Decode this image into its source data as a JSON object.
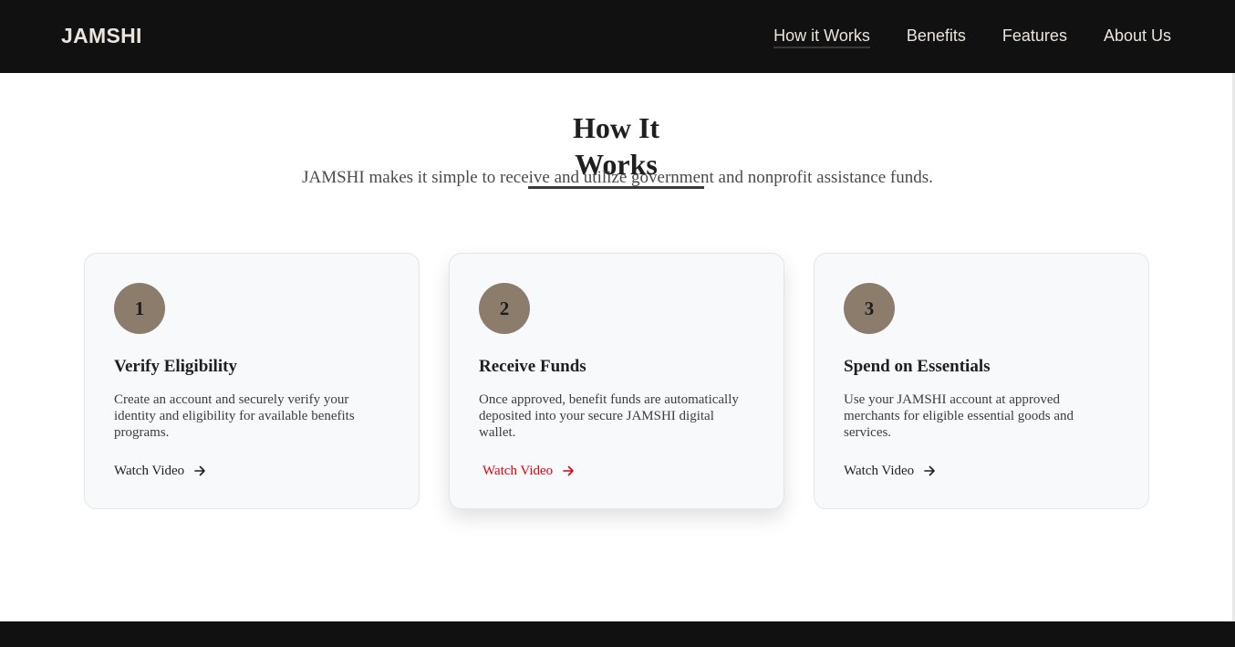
{
  "nav": {
    "logo": "JAMSHI",
    "links": [
      "How it Works",
      "Benefits",
      "Features",
      "About Us"
    ],
    "active_index": 0
  },
  "section": {
    "title": "How It Works",
    "subtitle": "JAMSHI makes it simple to receive and utilize government and nonprofit assistance funds."
  },
  "steps": [
    {
      "number": "1",
      "title": "Verify Eligibility",
      "description": "Create an account and securely verify your identity and eligibility for available benefits programs.",
      "link": "Watch Video"
    },
    {
      "number": "2",
      "title": "Receive Funds",
      "description": "Once approved, benefit funds are automatically deposited into your secure JAMSHI digital wallet.",
      "link": "Watch Video"
    },
    {
      "number": "3",
      "title": "Spend on Essentials",
      "description": "Use your JAMSHI account at approved merchants for eligible essential goods and services.",
      "link": "Watch Video"
    }
  ],
  "colors": {
    "nav_bg": "#111111",
    "nav_text": "#ebe4dc",
    "step_circle": "#8c7c6b",
    "link_hover": "#e00010",
    "card_bg": "#f8f9fb"
  },
  "icons": {
    "link_arrow": "arrow-right-icon"
  }
}
